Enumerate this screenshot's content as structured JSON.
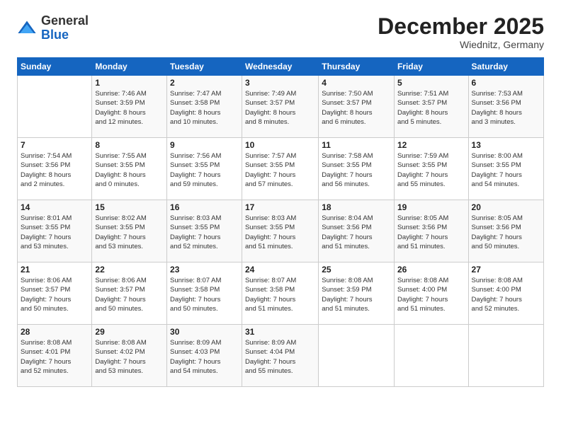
{
  "logo": {
    "general": "General",
    "blue": "Blue"
  },
  "header": {
    "month": "December 2025",
    "location": "Wiednitz, Germany"
  },
  "days_of_week": [
    "Sunday",
    "Monday",
    "Tuesday",
    "Wednesday",
    "Thursday",
    "Friday",
    "Saturday"
  ],
  "weeks": [
    [
      {
        "day": "",
        "info": ""
      },
      {
        "day": "1",
        "info": "Sunrise: 7:46 AM\nSunset: 3:59 PM\nDaylight: 8 hours\nand 12 minutes."
      },
      {
        "day": "2",
        "info": "Sunrise: 7:47 AM\nSunset: 3:58 PM\nDaylight: 8 hours\nand 10 minutes."
      },
      {
        "day": "3",
        "info": "Sunrise: 7:49 AM\nSunset: 3:57 PM\nDaylight: 8 hours\nand 8 minutes."
      },
      {
        "day": "4",
        "info": "Sunrise: 7:50 AM\nSunset: 3:57 PM\nDaylight: 8 hours\nand 6 minutes."
      },
      {
        "day": "5",
        "info": "Sunrise: 7:51 AM\nSunset: 3:57 PM\nDaylight: 8 hours\nand 5 minutes."
      },
      {
        "day": "6",
        "info": "Sunrise: 7:53 AM\nSunset: 3:56 PM\nDaylight: 8 hours\nand 3 minutes."
      }
    ],
    [
      {
        "day": "7",
        "info": "Sunrise: 7:54 AM\nSunset: 3:56 PM\nDaylight: 8 hours\nand 2 minutes."
      },
      {
        "day": "8",
        "info": "Sunrise: 7:55 AM\nSunset: 3:55 PM\nDaylight: 8 hours\nand 0 minutes."
      },
      {
        "day": "9",
        "info": "Sunrise: 7:56 AM\nSunset: 3:55 PM\nDaylight: 7 hours\nand 59 minutes."
      },
      {
        "day": "10",
        "info": "Sunrise: 7:57 AM\nSunset: 3:55 PM\nDaylight: 7 hours\nand 57 minutes."
      },
      {
        "day": "11",
        "info": "Sunrise: 7:58 AM\nSunset: 3:55 PM\nDaylight: 7 hours\nand 56 minutes."
      },
      {
        "day": "12",
        "info": "Sunrise: 7:59 AM\nSunset: 3:55 PM\nDaylight: 7 hours\nand 55 minutes."
      },
      {
        "day": "13",
        "info": "Sunrise: 8:00 AM\nSunset: 3:55 PM\nDaylight: 7 hours\nand 54 minutes."
      }
    ],
    [
      {
        "day": "14",
        "info": "Sunrise: 8:01 AM\nSunset: 3:55 PM\nDaylight: 7 hours\nand 53 minutes."
      },
      {
        "day": "15",
        "info": "Sunrise: 8:02 AM\nSunset: 3:55 PM\nDaylight: 7 hours\nand 53 minutes."
      },
      {
        "day": "16",
        "info": "Sunrise: 8:03 AM\nSunset: 3:55 PM\nDaylight: 7 hours\nand 52 minutes."
      },
      {
        "day": "17",
        "info": "Sunrise: 8:03 AM\nSunset: 3:55 PM\nDaylight: 7 hours\nand 51 minutes."
      },
      {
        "day": "18",
        "info": "Sunrise: 8:04 AM\nSunset: 3:56 PM\nDaylight: 7 hours\nand 51 minutes."
      },
      {
        "day": "19",
        "info": "Sunrise: 8:05 AM\nSunset: 3:56 PM\nDaylight: 7 hours\nand 51 minutes."
      },
      {
        "day": "20",
        "info": "Sunrise: 8:05 AM\nSunset: 3:56 PM\nDaylight: 7 hours\nand 50 minutes."
      }
    ],
    [
      {
        "day": "21",
        "info": "Sunrise: 8:06 AM\nSunset: 3:57 PM\nDaylight: 7 hours\nand 50 minutes."
      },
      {
        "day": "22",
        "info": "Sunrise: 8:06 AM\nSunset: 3:57 PM\nDaylight: 7 hours\nand 50 minutes."
      },
      {
        "day": "23",
        "info": "Sunrise: 8:07 AM\nSunset: 3:58 PM\nDaylight: 7 hours\nand 50 minutes."
      },
      {
        "day": "24",
        "info": "Sunrise: 8:07 AM\nSunset: 3:58 PM\nDaylight: 7 hours\nand 51 minutes."
      },
      {
        "day": "25",
        "info": "Sunrise: 8:08 AM\nSunset: 3:59 PM\nDaylight: 7 hours\nand 51 minutes."
      },
      {
        "day": "26",
        "info": "Sunrise: 8:08 AM\nSunset: 4:00 PM\nDaylight: 7 hours\nand 51 minutes."
      },
      {
        "day": "27",
        "info": "Sunrise: 8:08 AM\nSunset: 4:00 PM\nDaylight: 7 hours\nand 52 minutes."
      }
    ],
    [
      {
        "day": "28",
        "info": "Sunrise: 8:08 AM\nSunset: 4:01 PM\nDaylight: 7 hours\nand 52 minutes."
      },
      {
        "day": "29",
        "info": "Sunrise: 8:08 AM\nSunset: 4:02 PM\nDaylight: 7 hours\nand 53 minutes."
      },
      {
        "day": "30",
        "info": "Sunrise: 8:09 AM\nSunset: 4:03 PM\nDaylight: 7 hours\nand 54 minutes."
      },
      {
        "day": "31",
        "info": "Sunrise: 8:09 AM\nSunset: 4:04 PM\nDaylight: 7 hours\nand 55 minutes."
      },
      {
        "day": "",
        "info": ""
      },
      {
        "day": "",
        "info": ""
      },
      {
        "day": "",
        "info": ""
      }
    ]
  ]
}
